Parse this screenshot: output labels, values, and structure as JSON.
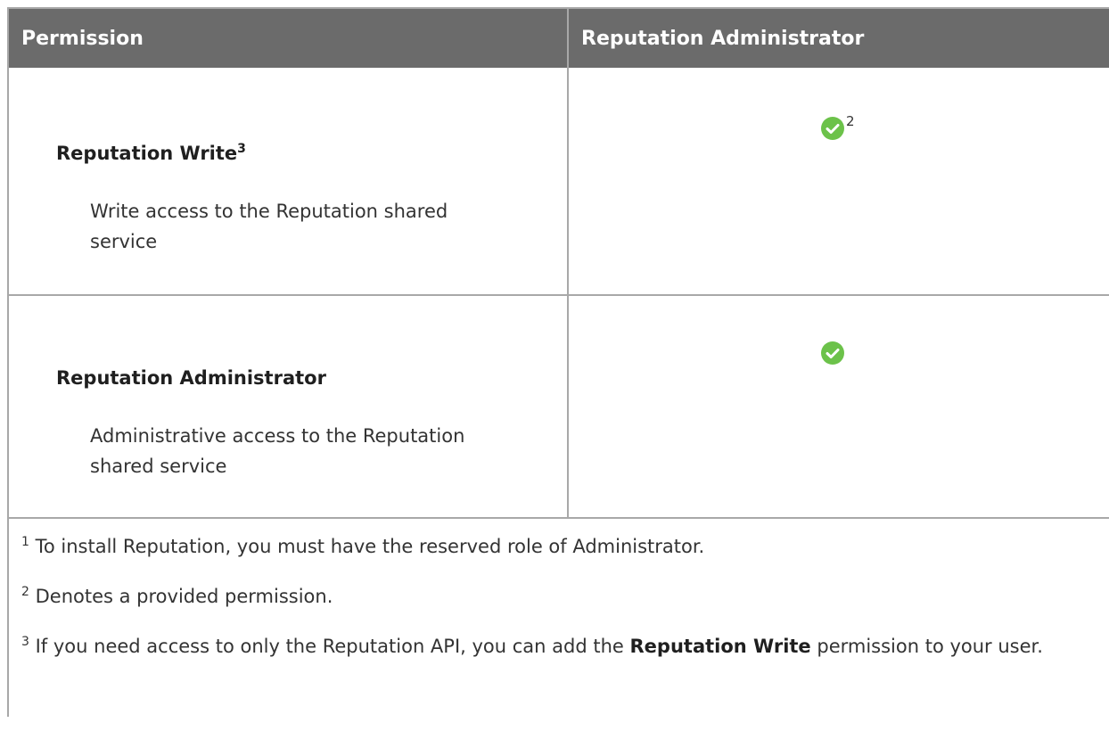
{
  "table": {
    "headers": [
      "Permission",
      "Reputation Administrator"
    ],
    "rows": [
      {
        "title": "Reputation Write",
        "title_sup": "3",
        "description": "Write access to the Reputation shared service",
        "granted": true,
        "granted_sup": "2"
      },
      {
        "title": "Reputation Administrator",
        "title_sup": "",
        "description": "Administrative access to the Reputation shared service",
        "granted": true,
        "granted_sup": ""
      }
    ]
  },
  "footnotes": [
    {
      "num": "1",
      "text": "To install Reputation, you must have the reserved role of Administrator."
    },
    {
      "num": "2",
      "text": "Denotes a provided permission."
    },
    {
      "num": "3",
      "text_before": "If you need access to only the Reputation API, you can add the ",
      "bold": "Reputation Write",
      "text_after": " permission to your user."
    }
  ],
  "colors": {
    "header_bg": "#6b6b6b",
    "header_text": "#ffffff",
    "border": "#a8a8a8",
    "check_green": "#6cc24a"
  },
  "icons": {
    "check": "check-circle-icon"
  }
}
